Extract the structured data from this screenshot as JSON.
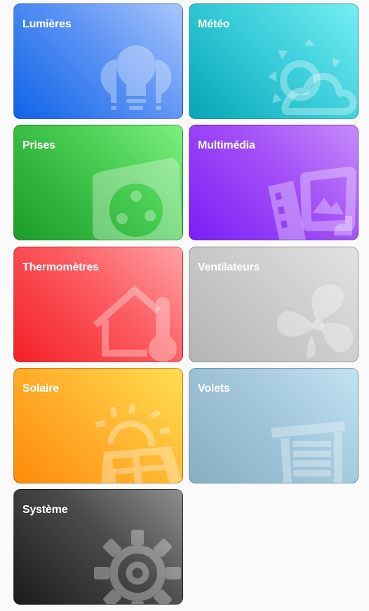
{
  "tiles": [
    {
      "label": "Lumières",
      "icon": "lightbulbs-icon",
      "color": "#0e63e8"
    },
    {
      "label": "Météo",
      "icon": "weather-partly-cloudy-icon",
      "color": "#06a5b5"
    },
    {
      "label": "Prises",
      "icon": "power-socket-icon",
      "color": "#1a9b2a"
    },
    {
      "label": "Multimédia",
      "icon": "multimedia-icon",
      "color": "#7a1ff4"
    },
    {
      "label": "Thermomètres",
      "icon": "home-thermometer-icon",
      "color": "#f41f26"
    },
    {
      "label": "Ventilateurs",
      "icon": "fan-icon",
      "color": "#b4b4b4"
    },
    {
      "label": "Solaire",
      "icon": "solar-panel-icon",
      "color": "#ff8a0a"
    },
    {
      "label": "Volets",
      "icon": "window-shutter-icon",
      "color": "#86afc4"
    },
    {
      "label": "Système",
      "icon": "gear-icon",
      "color": "#1a1a1a"
    }
  ]
}
